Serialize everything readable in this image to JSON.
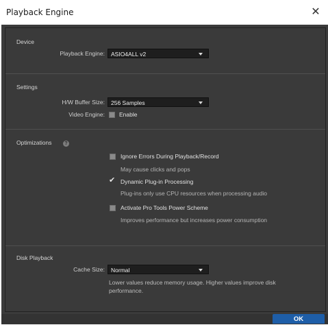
{
  "window": {
    "title": "Playback Engine",
    "close_glyph": "✕"
  },
  "device": {
    "heading": "Device",
    "playback_engine_label": "Playback Engine:",
    "playback_engine_value": "ASIO4ALL v2"
  },
  "settings": {
    "heading": "Settings",
    "buffer_label": "H/W Buffer Size:",
    "buffer_value": "256 Samples",
    "video_engine_label": "Video Engine:",
    "video_engine_option": "Enable",
    "video_engine_checked": false
  },
  "optimizations": {
    "heading": "Optimizations",
    "help_glyph": "?",
    "options": [
      {
        "label": "Ignore Errors During Playback/Record",
        "description": "May cause clicks and pops",
        "checked": false
      },
      {
        "label": "Dynamic Plug-in Processing",
        "description": "Plug-ins only use CPU resources when processing audio",
        "checked": true
      },
      {
        "label": "Activate Pro Tools Power Scheme",
        "description": "Improves performance but increases power consumption",
        "checked": false
      }
    ]
  },
  "disk_playback": {
    "heading": "Disk Playback",
    "cache_label": "Cache Size:",
    "cache_value": "Normal",
    "note_line1": "Lower values reduce memory usage. Higher values improve disk",
    "note_line2": "performance."
  },
  "buttons": {
    "ok": "OK"
  },
  "colors": {
    "panel_bg": "#3a3a3a",
    "dropdown_bg": "#1e1e1e",
    "ok_accent": "#1e5ea8"
  }
}
